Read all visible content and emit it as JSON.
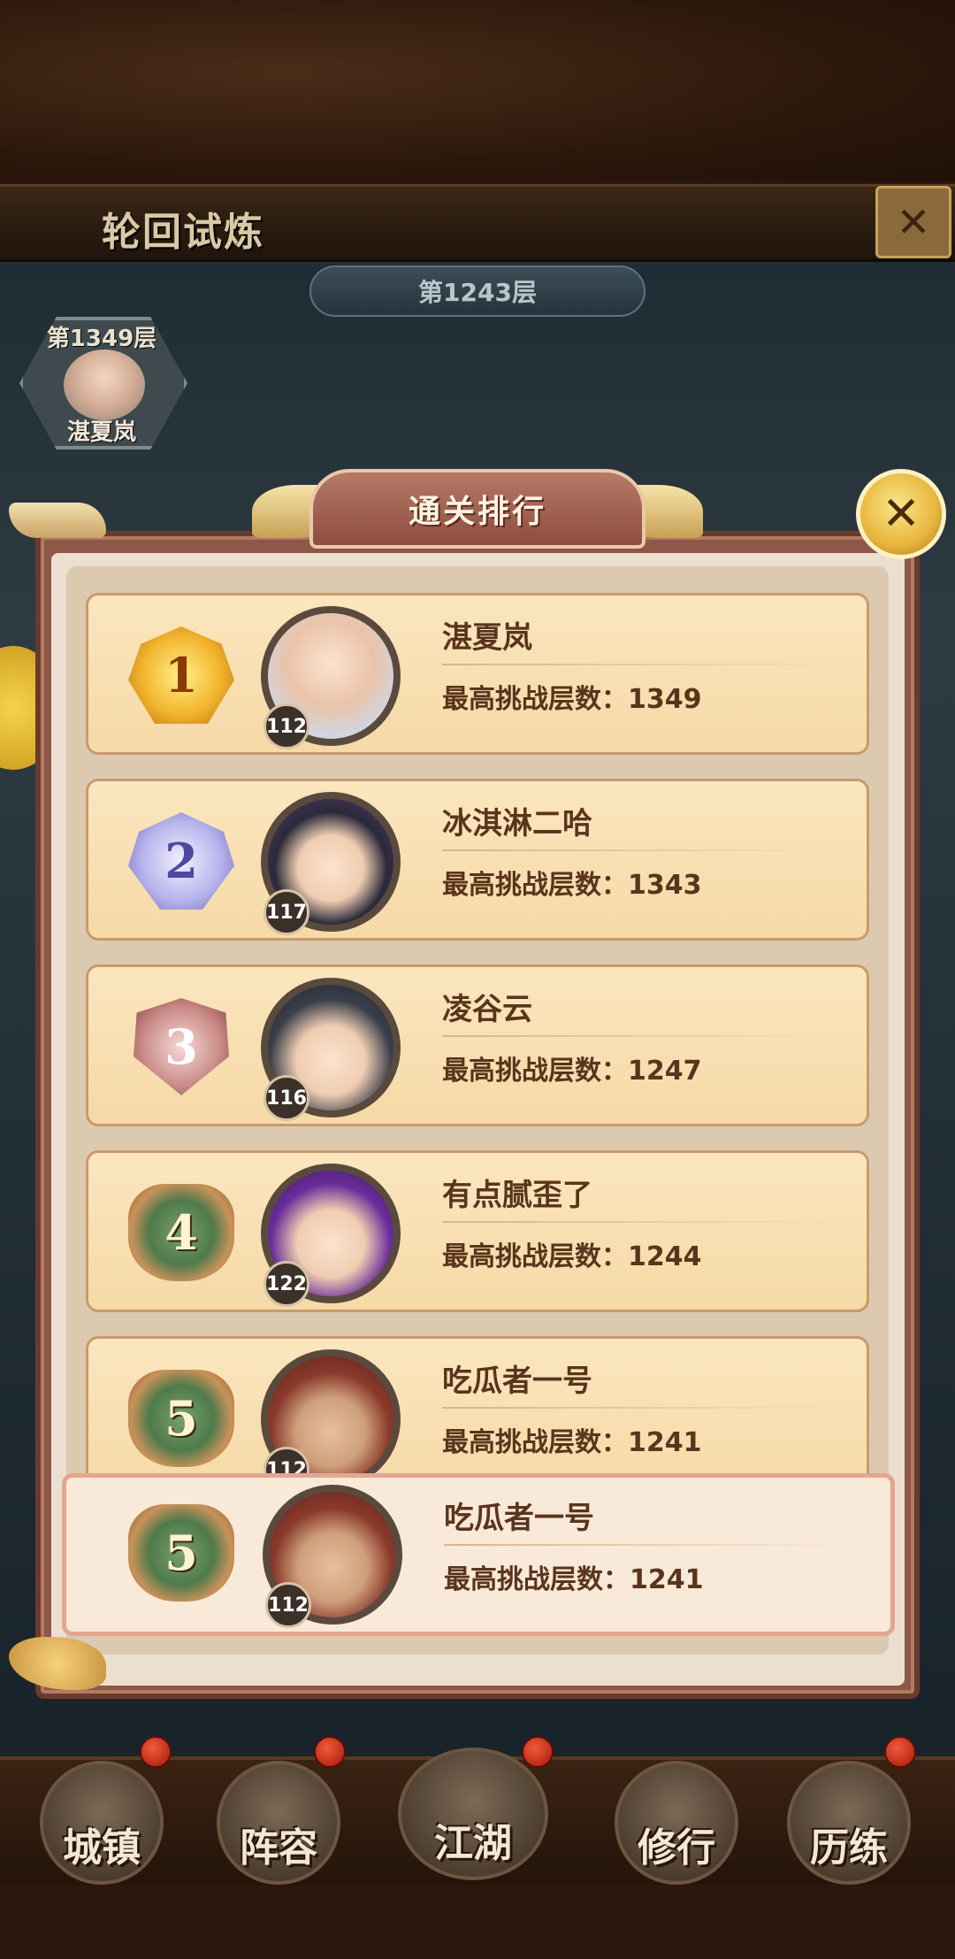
{
  "header": {
    "title": "轮回试炼",
    "close_icon": "close-icon"
  },
  "floor_banner": {
    "text": "第1243层"
  },
  "boss": {
    "floor": "第1349层",
    "name": "湛夏岚"
  },
  "modal": {
    "title": "通关排行",
    "close_icon": "close-icon"
  },
  "ranking": [
    {
      "rank": "1",
      "badge": "gold",
      "name": "湛夏岚",
      "level": "112",
      "label": "最高挑战层数：",
      "score": "1349"
    },
    {
      "rank": "2",
      "badge": "silver",
      "name": "冰淇淋二哈",
      "level": "117",
      "label": "最高挑战层数：",
      "score": "1343"
    },
    {
      "rank": "3",
      "badge": "bronze",
      "name": "凌谷云",
      "level": "116",
      "label": "最高挑战层数：",
      "score": "1247"
    },
    {
      "rank": "4",
      "badge": "plain",
      "name": "有点腻歪了",
      "level": "122",
      "label": "最高挑战层数：",
      "score": "1244"
    },
    {
      "rank": "5",
      "badge": "plain",
      "name": "吃瓜者一号",
      "level": "112",
      "label": "最高挑战层数：",
      "score": "1241"
    }
  ],
  "my_rank": {
    "rank": "5",
    "badge": "plain",
    "name": "吃瓜者一号",
    "level": "112",
    "label": "最高挑战层数：",
    "score": "1241"
  },
  "nav": [
    {
      "label": "城镇",
      "badge": true
    },
    {
      "label": "阵容",
      "badge": true
    },
    {
      "label": "江湖",
      "badge": true
    },
    {
      "label": "修行",
      "badge": false
    },
    {
      "label": "历练",
      "badge": true
    }
  ]
}
